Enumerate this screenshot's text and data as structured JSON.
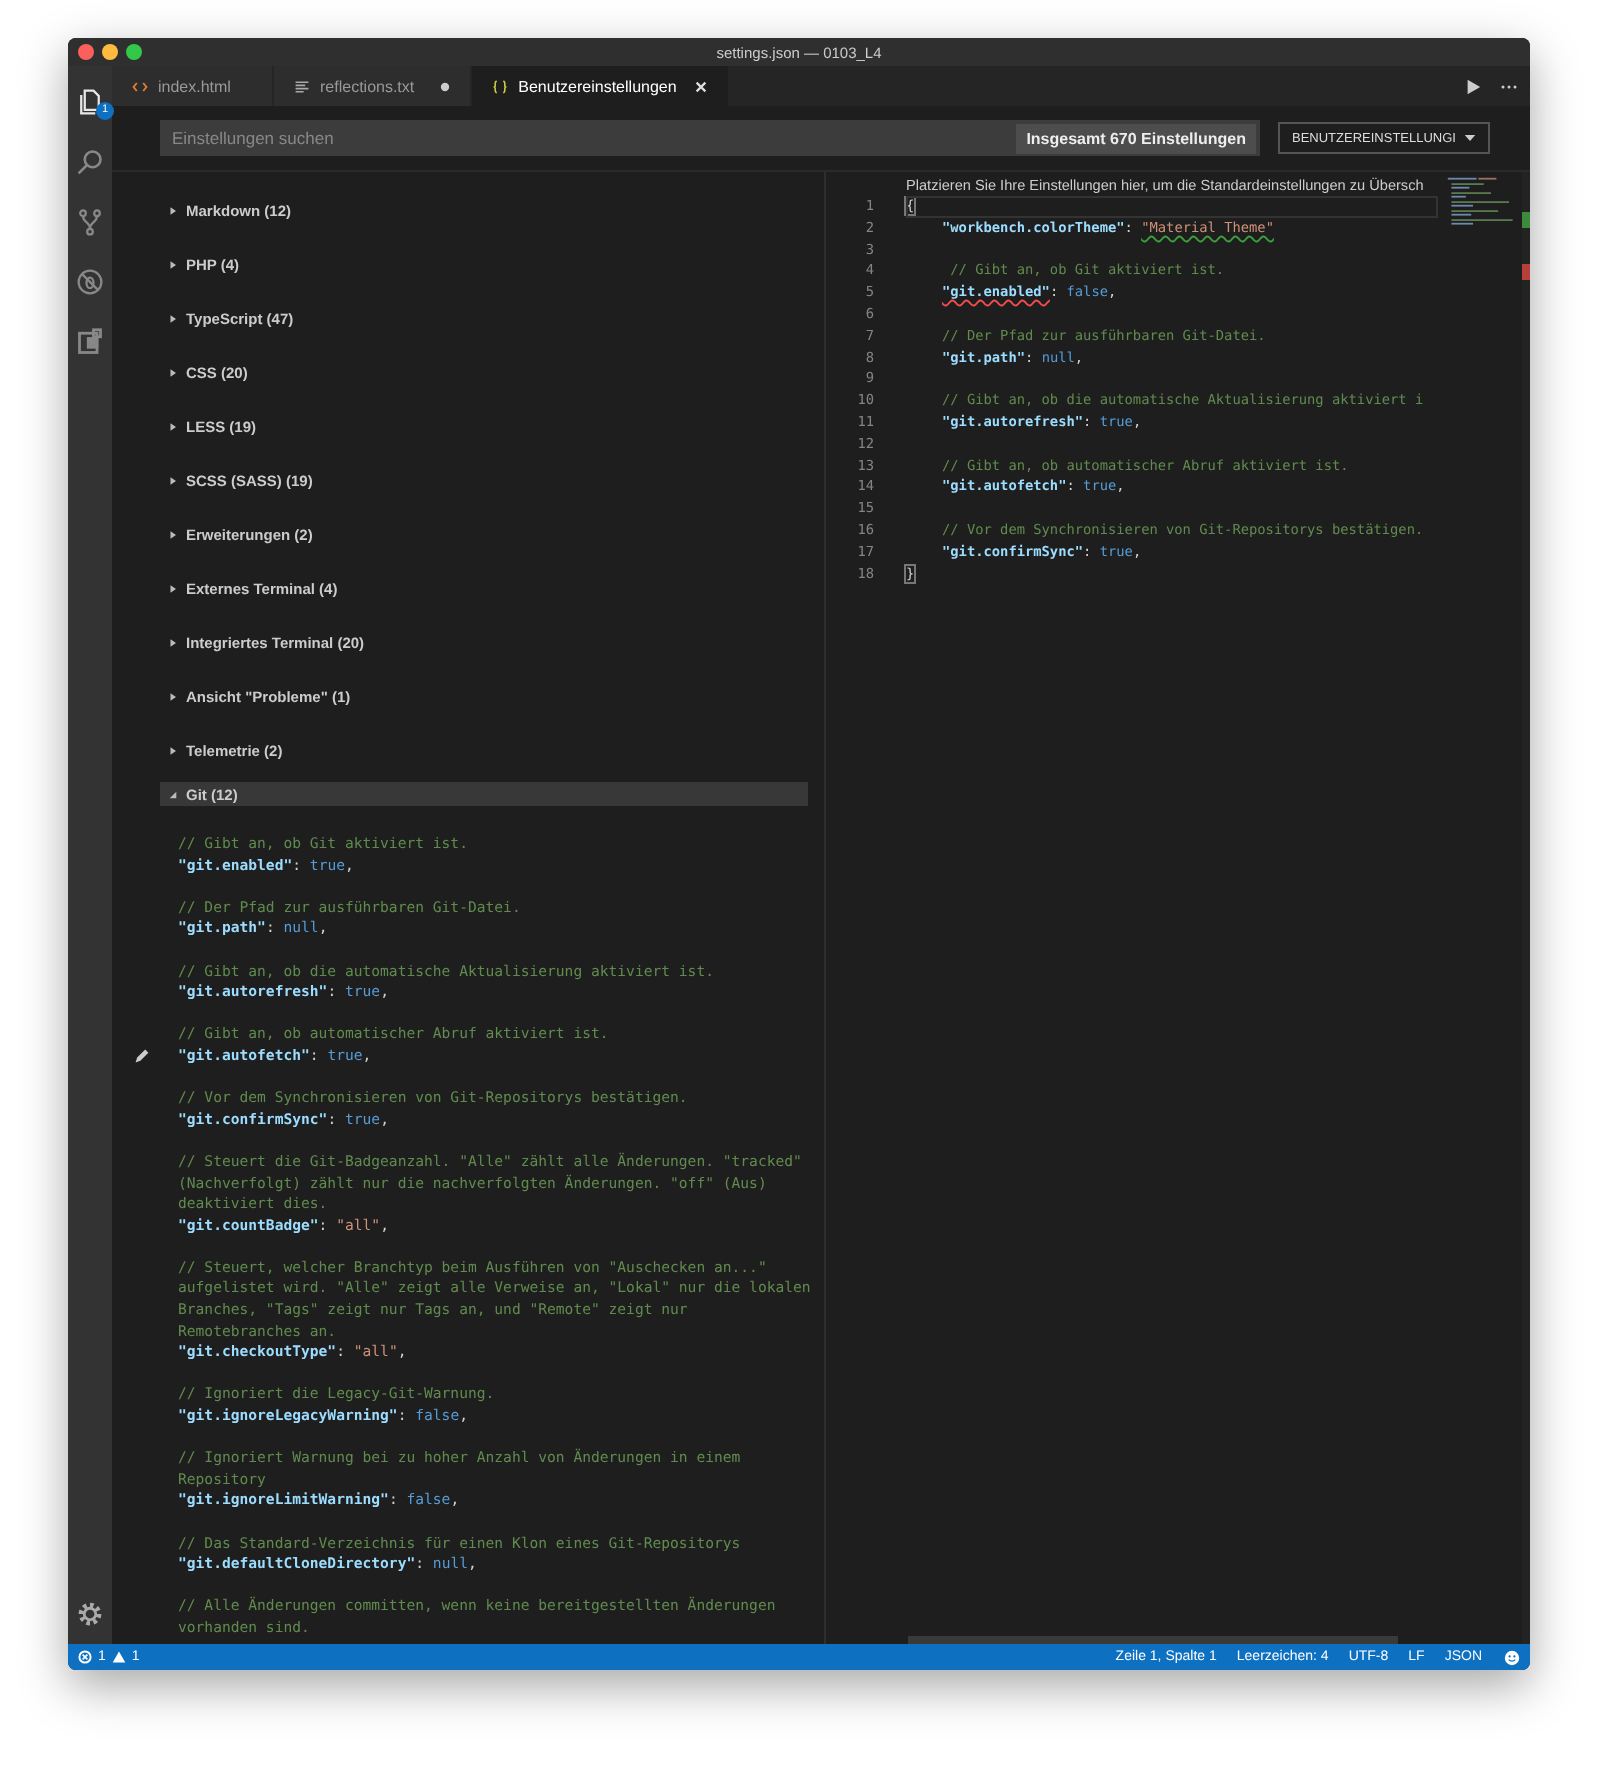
{
  "window": {
    "title": "settings.json — 0103_L4"
  },
  "activity_bar": {
    "items": [
      {
        "kind": "files",
        "selected": true,
        "badge": "1"
      },
      {
        "kind": "search",
        "selected": false
      },
      {
        "kind": "source-control",
        "selected": false
      },
      {
        "kind": "debug",
        "selected": false
      },
      {
        "kind": "extensions",
        "selected": false
      }
    ]
  },
  "tabs": [
    {
      "kind": "html",
      "label": "index.html",
      "selected": false,
      "dirty": false
    },
    {
      "kind": "text",
      "label": "reflections.txt",
      "selected": false,
      "dirty": true
    },
    {
      "kind": "json",
      "label": "Benutzereinstellungen",
      "selected": true,
      "dirty": false
    }
  ],
  "search": {
    "placeholder": "Einstellungen suchen",
    "count": "Insgesamt 670 Einstellungen",
    "scope": "BENUTZEREINSTELLUNGI"
  },
  "categories": [
    {
      "label": "Markdown (12)",
      "expanded": false
    },
    {
      "label": "PHP (4)",
      "expanded": false
    },
    {
      "label": "TypeScript (47)",
      "expanded": false
    },
    {
      "label": "CSS (20)",
      "expanded": false
    },
    {
      "label": "LESS (19)",
      "expanded": false
    },
    {
      "label": "SCSS (SASS) (19)",
      "expanded": false
    },
    {
      "label": "Erweiterungen (2)",
      "expanded": false
    },
    {
      "label": "Externes Terminal (4)",
      "expanded": false
    },
    {
      "label": "Integriertes Terminal (20)",
      "expanded": false
    },
    {
      "label": "Ansicht \"Probleme\" (1)",
      "expanded": false
    },
    {
      "label": "Telemetrie (2)",
      "expanded": false
    },
    {
      "label": "Git (12)",
      "expanded": true
    }
  ],
  "default_settings": [
    {
      "hovered": false,
      "lines": [
        [
          {
            "kind": "comment",
            "text": "// Gibt an, ob Git aktiviert ist."
          }
        ],
        [
          {
            "kind": "key",
            "text": "\"git.enabled\""
          },
          {
            "kind": "punct",
            "text": ": "
          },
          {
            "kind": "keyword",
            "text": "true"
          },
          {
            "kind": "punct",
            "text": ","
          }
        ]
      ]
    },
    {
      "hovered": false,
      "lines": [
        [
          {
            "kind": "comment",
            "text": "// Der Pfad zur ausführbaren Git-Datei."
          }
        ],
        [
          {
            "kind": "key",
            "text": "\"git.path\""
          },
          {
            "kind": "punct",
            "text": ": "
          },
          {
            "kind": "keyword",
            "text": "null"
          },
          {
            "kind": "punct",
            "text": ","
          }
        ]
      ]
    },
    {
      "hovered": false,
      "lines": [
        [
          {
            "kind": "comment",
            "text": "// Gibt an, ob die automatische Aktualisierung aktiviert ist."
          }
        ],
        [
          {
            "kind": "key",
            "text": "\"git.autorefresh\""
          },
          {
            "kind": "punct",
            "text": ": "
          },
          {
            "kind": "keyword",
            "text": "true"
          },
          {
            "kind": "punct",
            "text": ","
          }
        ]
      ]
    },
    {
      "hovered": true,
      "lines": [
        [
          {
            "kind": "comment",
            "text": "// Gibt an, ob automatischer Abruf aktiviert ist."
          }
        ],
        [
          {
            "kind": "key",
            "text": "\"git.autofetch\""
          },
          {
            "kind": "punct",
            "text": ": "
          },
          {
            "kind": "keyword",
            "text": "true"
          },
          {
            "kind": "punct",
            "text": ","
          }
        ]
      ]
    },
    {
      "hovered": false,
      "lines": [
        [
          {
            "kind": "comment",
            "text": "// Vor dem Synchronisieren von Git-Repositorys bestätigen."
          }
        ],
        [
          {
            "kind": "key",
            "text": "\"git.confirmSync\""
          },
          {
            "kind": "punct",
            "text": ": "
          },
          {
            "kind": "keyword",
            "text": "true"
          },
          {
            "kind": "punct",
            "text": ","
          }
        ]
      ]
    },
    {
      "hovered": false,
      "lines": [
        [
          {
            "kind": "comment",
            "text": "// Steuert die Git-Badgeanzahl. \"Alle\" zählt alle Änderungen. \"tracked\""
          }
        ],
        [
          {
            "kind": "comment",
            "text": "(Nachverfolgt) zählt nur die nachverfolgten Änderungen. \"off\" (Aus)"
          }
        ],
        [
          {
            "kind": "comment",
            "text": "deaktiviert dies."
          }
        ],
        [
          {
            "kind": "key",
            "text": "\"git.countBadge\""
          },
          {
            "kind": "punct",
            "text": ": "
          },
          {
            "kind": "string",
            "text": "\"all\""
          },
          {
            "kind": "punct",
            "text": ","
          }
        ]
      ]
    },
    {
      "hovered": false,
      "lines": [
        [
          {
            "kind": "comment",
            "text": "// Steuert, welcher Branchtyp beim Ausführen von \"Auschecken an...\""
          }
        ],
        [
          {
            "kind": "comment",
            "text": "aufgelistet wird. \"Alle\" zeigt alle Verweise an, \"Lokal\" nur die lokalen"
          }
        ],
        [
          {
            "kind": "comment",
            "text": "Branches, \"Tags\" zeigt nur Tags an, und \"Remote\" zeigt nur"
          }
        ],
        [
          {
            "kind": "comment",
            "text": "Remotebranches an."
          }
        ],
        [
          {
            "kind": "key",
            "text": "\"git.checkoutType\""
          },
          {
            "kind": "punct",
            "text": ": "
          },
          {
            "kind": "string",
            "text": "\"all\""
          },
          {
            "kind": "punct",
            "text": ","
          }
        ]
      ]
    },
    {
      "hovered": false,
      "lines": [
        [
          {
            "kind": "comment",
            "text": "// Ignoriert die Legacy-Git-Warnung."
          }
        ],
        [
          {
            "kind": "key",
            "text": "\"git.ignoreLegacyWarning\""
          },
          {
            "kind": "punct",
            "text": ": "
          },
          {
            "kind": "keyword",
            "text": "false"
          },
          {
            "kind": "punct",
            "text": ","
          }
        ]
      ]
    },
    {
      "hovered": false,
      "lines": [
        [
          {
            "kind": "comment",
            "text": "// Ignoriert Warnung bei zu hoher Anzahl von Änderungen in einem"
          }
        ],
        [
          {
            "kind": "comment",
            "text": "Repository"
          }
        ],
        [
          {
            "kind": "key",
            "text": "\"git.ignoreLimitWarning\""
          },
          {
            "kind": "punct",
            "text": ": "
          },
          {
            "kind": "keyword",
            "text": "false"
          },
          {
            "kind": "punct",
            "text": ","
          }
        ]
      ]
    },
    {
      "hovered": false,
      "lines": [
        [
          {
            "kind": "comment",
            "text": "// Das Standard-Verzeichnis für einen Klon eines Git-Repositorys"
          }
        ],
        [
          {
            "kind": "key",
            "text": "\"git.defaultCloneDirectory\""
          },
          {
            "kind": "punct",
            "text": ": "
          },
          {
            "kind": "keyword",
            "text": "null"
          },
          {
            "kind": "punct",
            "text": ","
          }
        ]
      ]
    },
    {
      "hovered": false,
      "lines": [
        [
          {
            "kind": "comment",
            "text": "// Alle Änderungen committen, wenn keine bereitgestellten Änderungen"
          }
        ],
        [
          {
            "kind": "comment",
            "text": "vorhanden sind."
          }
        ]
      ]
    }
  ],
  "user_settings": {
    "hint": "Platzieren Sie Ihre Einstellungen hier, um die Standardeinstellungen zu Übersch",
    "lines": [
      {
        "number": "1",
        "current": true,
        "tokens": [
          {
            "kind": "bracket",
            "text": "{"
          }
        ]
      },
      {
        "number": "2",
        "current": false,
        "tokens": [
          {
            "kind": "key",
            "text": "\"workbench.colorTheme\""
          },
          {
            "kind": "punct",
            "text": ": "
          },
          {
            "kind": "string",
            "text": "\"Material Theme\"",
            "warning": true
          }
        ]
      },
      {
        "number": "3",
        "current": false
      },
      {
        "number": "4",
        "current": false,
        "tokens": [
          {
            "kind": "comment",
            "text": " // Gibt an, ob Git aktiviert ist."
          }
        ]
      },
      {
        "number": "5",
        "current": false,
        "tokens": [
          {
            "kind": "key",
            "text": "\"git.enabled\"",
            "error": true
          },
          {
            "kind": "punct",
            "text": ": "
          },
          {
            "kind": "keyword",
            "text": "false"
          },
          {
            "kind": "punct",
            "text": ","
          }
        ]
      },
      {
        "number": "6",
        "current": false
      },
      {
        "number": "7",
        "current": false,
        "tokens": [
          {
            "kind": "comment",
            "text": "// Der Pfad zur ausführbaren Git-Datei."
          }
        ]
      },
      {
        "number": "8",
        "current": false,
        "tokens": [
          {
            "kind": "key",
            "text": "\"git.path\""
          },
          {
            "kind": "punct",
            "text": ": "
          },
          {
            "kind": "keyword",
            "text": "null"
          },
          {
            "kind": "punct",
            "text": ","
          }
        ]
      },
      {
        "number": "9",
        "current": false
      },
      {
        "number": "10",
        "current": false,
        "tokens": [
          {
            "kind": "comment",
            "text": "// Gibt an, ob die automatische Aktualisierung aktiviert i"
          }
        ]
      },
      {
        "number": "11",
        "current": false,
        "tokens": [
          {
            "kind": "key",
            "text": "\"git.autorefresh\""
          },
          {
            "kind": "punct",
            "text": ": "
          },
          {
            "kind": "keyword",
            "text": "true"
          },
          {
            "kind": "punct",
            "text": ","
          }
        ]
      },
      {
        "number": "12",
        "current": false
      },
      {
        "number": "13",
        "current": false,
        "tokens": [
          {
            "kind": "comment",
            "text": "// Gibt an, ob automatischer Abruf aktiviert ist."
          }
        ]
      },
      {
        "number": "14",
        "current": false,
        "tokens": [
          {
            "kind": "key",
            "text": "\"git.autofetch\""
          },
          {
            "kind": "punct",
            "text": ": "
          },
          {
            "kind": "keyword",
            "text": "true"
          },
          {
            "kind": "punct",
            "text": ","
          }
        ]
      },
      {
        "number": "15",
        "current": false
      },
      {
        "number": "16",
        "current": false,
        "tokens": [
          {
            "kind": "comment",
            "text": "// Vor dem Synchronisieren von Git-Repositorys bestätigen."
          }
        ]
      },
      {
        "number": "17",
        "current": false,
        "tokens": [
          {
            "kind": "key",
            "text": "\"git.confirmSync\""
          },
          {
            "kind": "punct",
            "text": ": "
          },
          {
            "kind": "keyword",
            "text": "true"
          },
          {
            "kind": "punct",
            "text": ","
          }
        ]
      },
      {
        "number": "18",
        "current": false,
        "tokens": [
          {
            "kind": "bracket",
            "text": "}"
          }
        ]
      }
    ]
  },
  "status_bar": {
    "errors": "1",
    "warnings": "1",
    "items": [
      "Zeile 1, Spalte 1",
      "Leerzeichen: 4",
      "UTF-8",
      "LF",
      "JSON"
    ]
  }
}
